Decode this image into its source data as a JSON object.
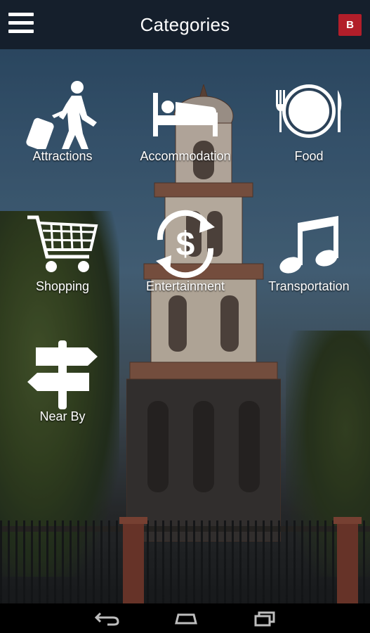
{
  "appbar": {
    "title": "Categories",
    "badge": "B",
    "menu_icon": "hamburger-menu-icon"
  },
  "categories": [
    {
      "label": "Attractions",
      "icon": "traveler-luggage-icon"
    },
    {
      "label": "Accommodation",
      "icon": "bed-icon"
    },
    {
      "label": "Food",
      "icon": "plate-fork-knife-icon"
    },
    {
      "label": "Shopping",
      "icon": "shopping-cart-icon"
    },
    {
      "label": "Entertainment",
      "icon": "dollar-exchange-icon"
    },
    {
      "label": "Transportation",
      "icon": "music-note-icon"
    },
    {
      "label": "Near By",
      "icon": "signpost-icon"
    }
  ],
  "navbar": {
    "back_icon": "back-icon",
    "home_icon": "home-icon",
    "recents_icon": "recent-apps-icon"
  },
  "colors": {
    "appbar": "#151f2c",
    "badge": "#b21e2a",
    "icon": "#ffffff"
  }
}
